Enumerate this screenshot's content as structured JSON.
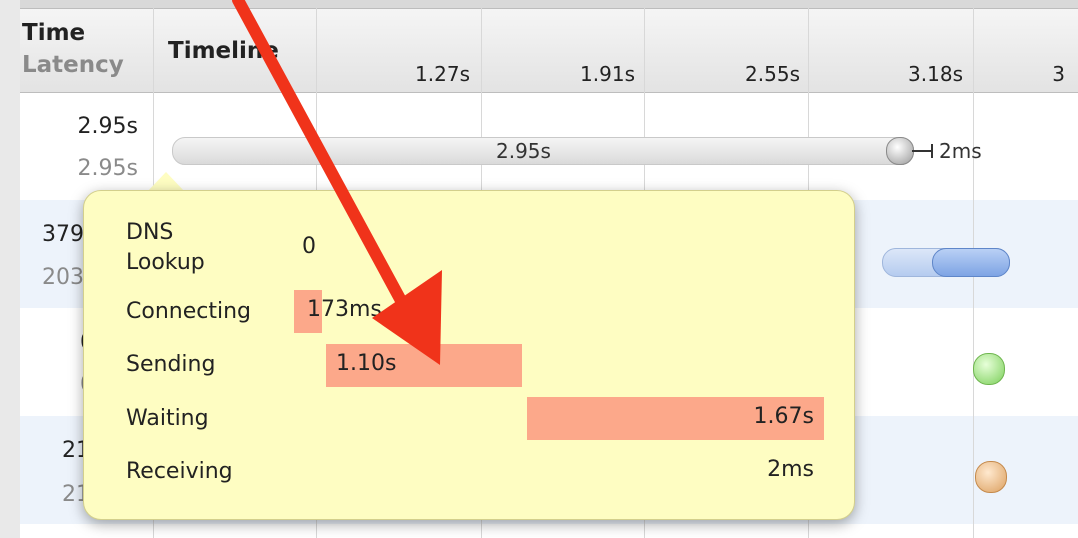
{
  "header": {
    "time_label": "Time",
    "latency_label": "Latency",
    "timeline_label": "Timeline",
    "ticks": [
      "1.27s",
      "1.91s",
      "2.55s",
      "3.18s",
      "3"
    ]
  },
  "rows": [
    {
      "time": "2.95s",
      "latency": "2.95s"
    },
    {
      "time": "379",
      "latency": "203"
    },
    {
      "time": "0",
      "latency": "0"
    },
    {
      "time": "21",
      "latency": "210"
    }
  ],
  "timeline_bar": {
    "duration": "2.95s",
    "tail": "2ms"
  },
  "tooltip": {
    "items": [
      {
        "label": "DNS Lookup",
        "value": "0"
      },
      {
        "label": "Connecting",
        "value": "173ms"
      },
      {
        "label": "Sending",
        "value": "1.10s"
      },
      {
        "label": "Waiting",
        "value": "1.67s"
      },
      {
        "label": "Receiving",
        "value": "2ms"
      }
    ]
  },
  "colors": {
    "tooltip_bg": "#fefdc2",
    "segment": "#fca88a",
    "annotation_arrow": "#f0331a",
    "blue_bar": "#8fb1ea",
    "green_dot": "#8fd872",
    "orange_dot": "#e9b27a"
  },
  "icons": [
    "annotation-arrow"
  ]
}
